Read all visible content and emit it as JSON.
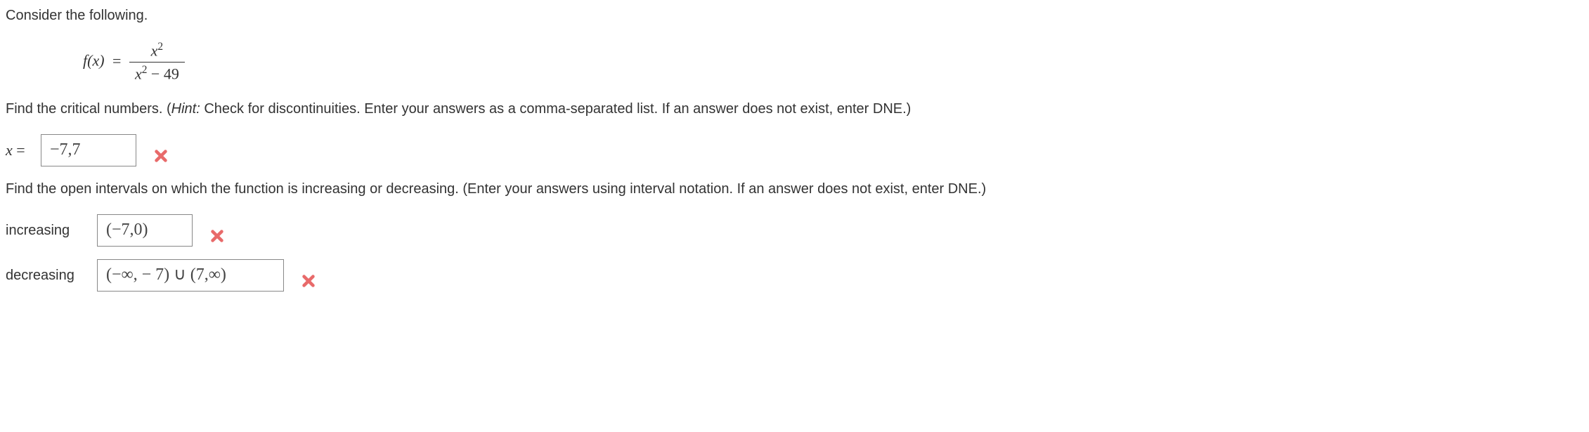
{
  "intro": "Consider the following.",
  "formula": {
    "lhs_fx": "f(x)",
    "eq": "=",
    "numerator_x": "x",
    "numerator_sup": "2",
    "denominator_x": "x",
    "denominator_sup": "2",
    "denominator_tail": " − 49"
  },
  "prompt1_a": "Find the critical numbers. (",
  "prompt1_hint_label": "Hint:",
  "prompt1_b": " Check for discontinuities. Enter your answers as a comma-separated list. If an answer does not exist, enter DNE.)",
  "answer1": {
    "label_var": "x",
    "label_eq": " =",
    "value": "−7,7"
  },
  "prompt2": "Find the open intervals on which the function is increasing or decreasing. (Enter your answers using interval notation. If an answer does not exist, enter DNE.)",
  "answer2": {
    "label": "increasing",
    "value": "(−7,0)"
  },
  "answer3": {
    "label": "decreasing",
    "value": "(−∞, − 7) ∪ (7,∞)"
  }
}
